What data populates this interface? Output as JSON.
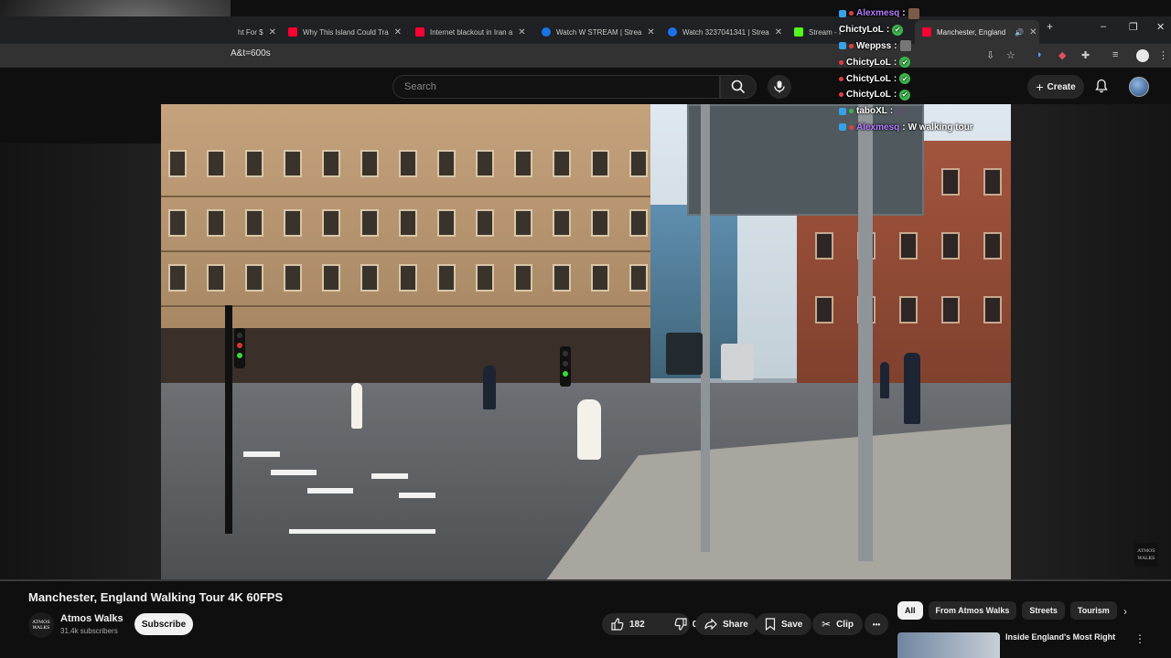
{
  "browser": {
    "tabs": [
      {
        "label": "ht For $",
        "favicon": "youtube-icon",
        "active": false
      },
      {
        "label": "Why This Island Could Tra",
        "favicon": "youtube-icon",
        "active": false
      },
      {
        "label": "Internet blackout in Iran a",
        "favicon": "youtube-icon",
        "active": false
      },
      {
        "label": "Watch W STREAM | Strea",
        "favicon": "stream-icon",
        "active": false
      },
      {
        "label": "Watch 3237041341 | Strea",
        "favicon": "stream-icon",
        "active": false
      },
      {
        "label": "Stream - I",
        "favicon": "kick-icon",
        "active": false
      },
      {
        "label": "Manchester, England",
        "favicon": "youtube-icon",
        "active": true
      }
    ],
    "url": "A&t=600s",
    "new_tab": "+",
    "window_controls": {
      "minimize": "–",
      "restore": "❐",
      "close": "✕"
    }
  },
  "youtube": {
    "search_placeholder": "Search",
    "create_label": "Create"
  },
  "chat": [
    {
      "user": "Alexmesq",
      "color": "#b57bff",
      "message": "",
      "emote": "square"
    },
    {
      "user": "ChictyLoL",
      "color": "#ffffff",
      "message": "",
      "emote": "check"
    },
    {
      "user": "Weppss",
      "color": "#ffffff",
      "message": "",
      "emote": "square"
    },
    {
      "user": "ChictyLoL",
      "color": "#ffffff",
      "message": "",
      "emote": "check"
    },
    {
      "user": "ChictyLoL",
      "color": "#ffffff",
      "message": "",
      "emote": "check"
    },
    {
      "user": "ChictyLoL",
      "color": "#ffffff",
      "message": "",
      "emote": "check"
    },
    {
      "user": "taboXL",
      "color": "#ffffff",
      "message": "",
      "emote": "square"
    },
    {
      "user": "Alexmesq",
      "color": "#b57bff",
      "message": "W walking tour",
      "emote": ""
    }
  ],
  "video": {
    "title": "Manchester, England Walking Tour 4K 60FPS",
    "watermark": "ATMOS WALKS",
    "channel_name": "Atmos Walks",
    "channel_avatar_text": "ATMOS WALKS",
    "subscribers": "31.4k subscribers",
    "subscribe_label": "Subscribe",
    "likes": "182",
    "dislikes": "0",
    "share_label": "Share",
    "save_label": "Save",
    "clip_label": "Clip",
    "more_label": "•••"
  },
  "chips": [
    "All",
    "From Atmos Walks",
    "Streets",
    "Tourism"
  ],
  "recommendation": {
    "title": "Inside England's Most Right"
  },
  "colors": {
    "accent": "#ff0033",
    "background": "#0f0f0f",
    "chip_selected": "#f1f1f1"
  }
}
